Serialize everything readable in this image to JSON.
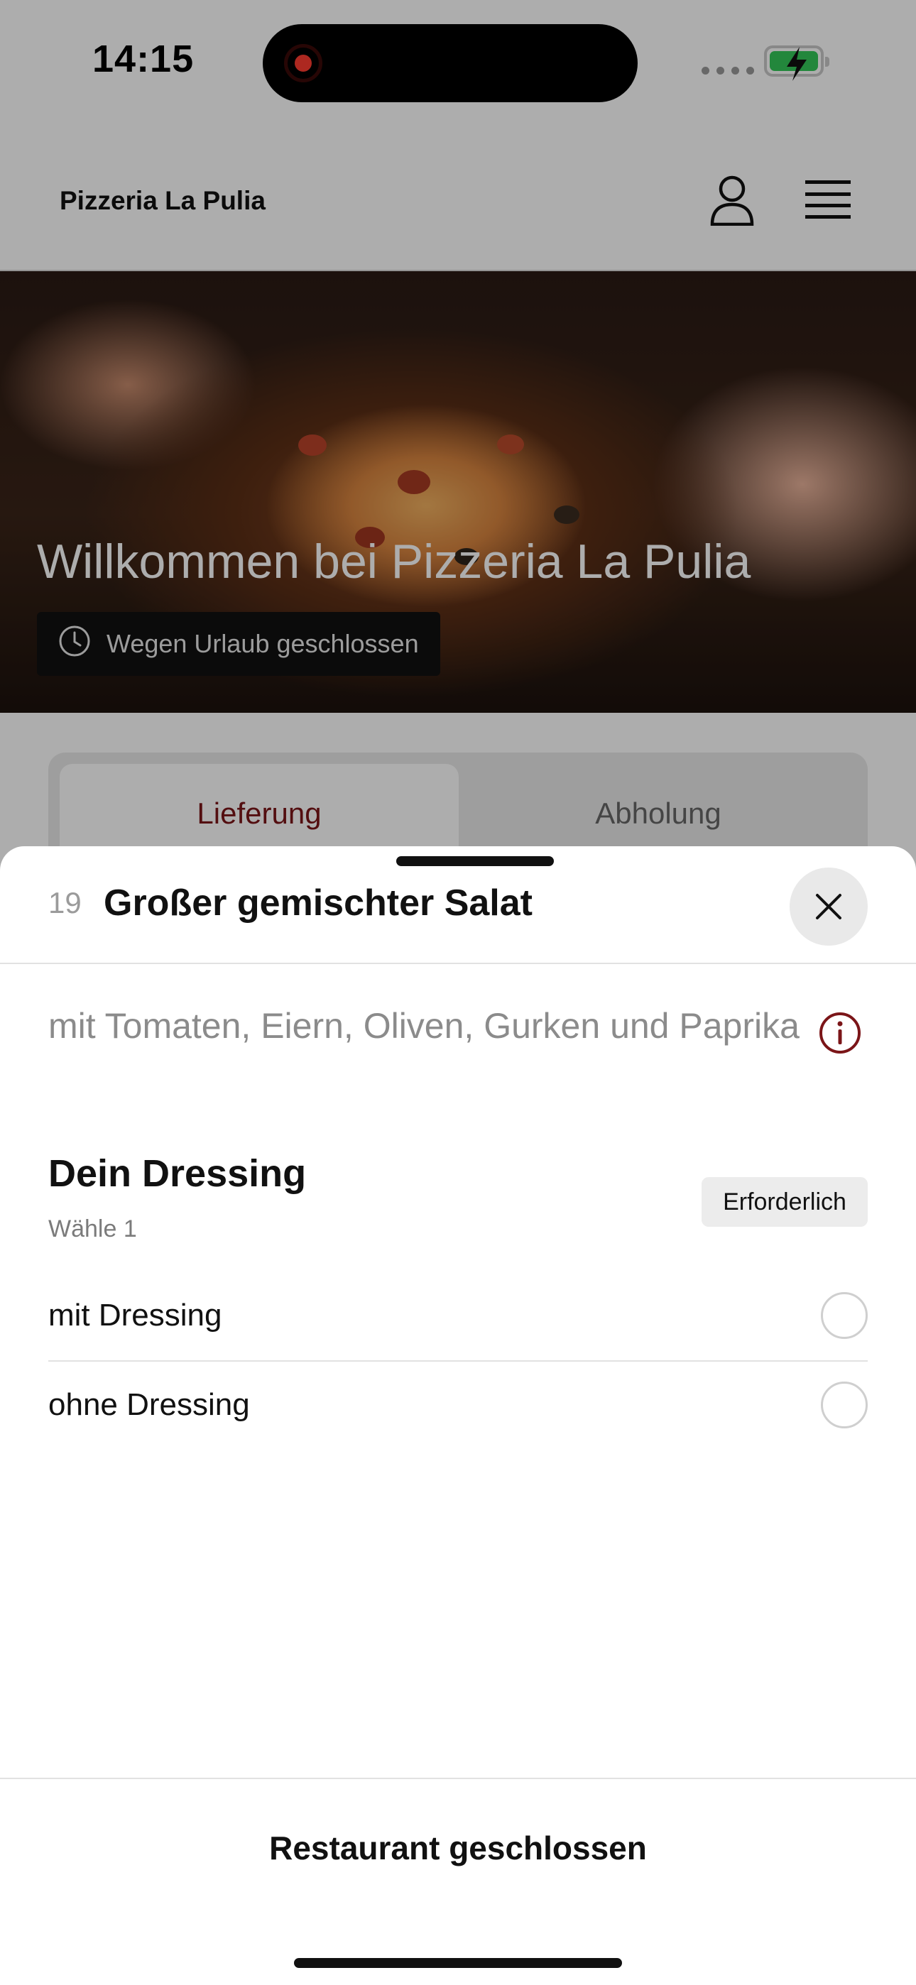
{
  "status_bar": {
    "time": "14:15"
  },
  "header": {
    "brand": "Pizzeria La Pulia"
  },
  "hero": {
    "title": "Willkommen bei Pizzeria La Pulia",
    "status_text": "Wegen Urlaub geschlossen"
  },
  "tabs": [
    {
      "label": "Lieferung",
      "active": true
    },
    {
      "label": "Abholung",
      "active": false
    }
  ],
  "item": {
    "number": "19",
    "title": "Großer gemischter Salat",
    "description": "mit Tomaten, Eiern, Oliven, Gurken und Paprika"
  },
  "option_group": {
    "title": "Dein Dressing",
    "subtitle": "Wähle 1",
    "badge": "Erforderlich",
    "options": [
      {
        "label": "mit Dressing",
        "selected": false
      },
      {
        "label": "ohne Dressing",
        "selected": false
      }
    ]
  },
  "footer": {
    "button_label": "Restaurant geschlossen"
  },
  "colors": {
    "accent": "#7b1518",
    "dim_overlay": "rgba(0,0,0,0.32)"
  },
  "icons": [
    "user-icon",
    "menu-icon",
    "clock-icon",
    "close-icon",
    "info-icon"
  ]
}
